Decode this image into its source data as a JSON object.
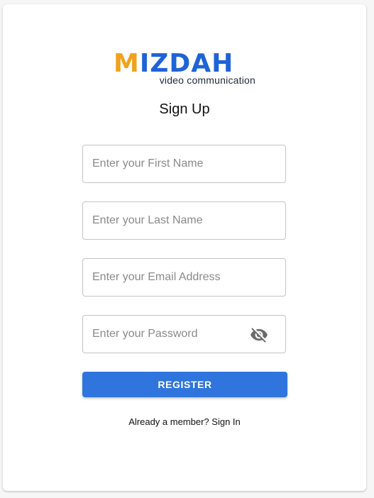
{
  "brand": {
    "logo_wordmark": "MIZDAH",
    "logo_tagline": "video communication",
    "primary_color": "#1f63d6",
    "accent_color": "#f0a21c"
  },
  "form": {
    "title": "Sign Up",
    "first_name": {
      "placeholder": "Enter your First Name",
      "value": ""
    },
    "last_name": {
      "placeholder": "Enter your Last Name",
      "value": ""
    },
    "email": {
      "placeholder": "Enter your Email Address",
      "value": ""
    },
    "password": {
      "placeholder": "Enter your Password",
      "value": "",
      "visibility_icon": "eye-off-icon"
    },
    "register_label": "REGISTER",
    "button_color": "#2f75dd",
    "member_prompt": "Already a member?",
    "signin_link": "Sign In"
  }
}
